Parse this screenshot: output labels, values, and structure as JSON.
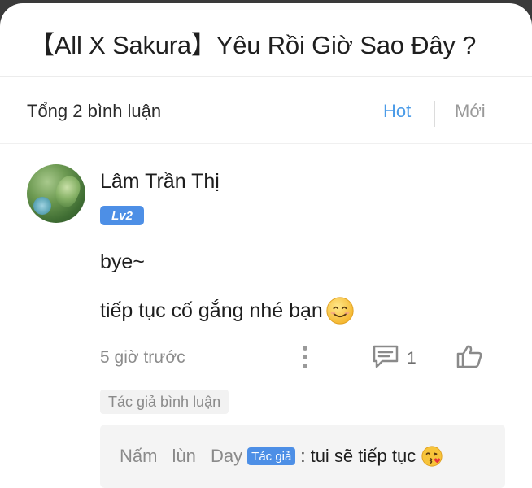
{
  "story": {
    "title": "【All X Sakura】Yêu Rồi Giờ Sao Đây ?"
  },
  "comments_header": {
    "total_label": "Tổng 2 bình luận",
    "tab_hot": "Hot",
    "tab_new": "Mới",
    "active_tab": "Hot"
  },
  "comment": {
    "username": "Lâm Trần Thị",
    "level": "Lv2",
    "lines": [
      "bye~",
      "tiếp tục cố gắng nhé bạn"
    ],
    "time": "5 giờ trước",
    "reply_count": "1",
    "author_tag": "Tác giả bình luận",
    "icons": {
      "emoji_1": "smiling-face-icon",
      "more": "more-vertical-icon",
      "reply": "comment-icon",
      "like": "thumbs-up-icon"
    }
  },
  "reply": {
    "name": "Nấm lùn Day",
    "badge": "Tác giả",
    "text": ": tui sẽ tiếp tục",
    "icon": "kissing-face-icon"
  },
  "colors": {
    "accent": "#4a9be8",
    "badge": "#4d8fe6",
    "muted": "#8c8c8c",
    "reply_bg": "#f4f4f4"
  }
}
